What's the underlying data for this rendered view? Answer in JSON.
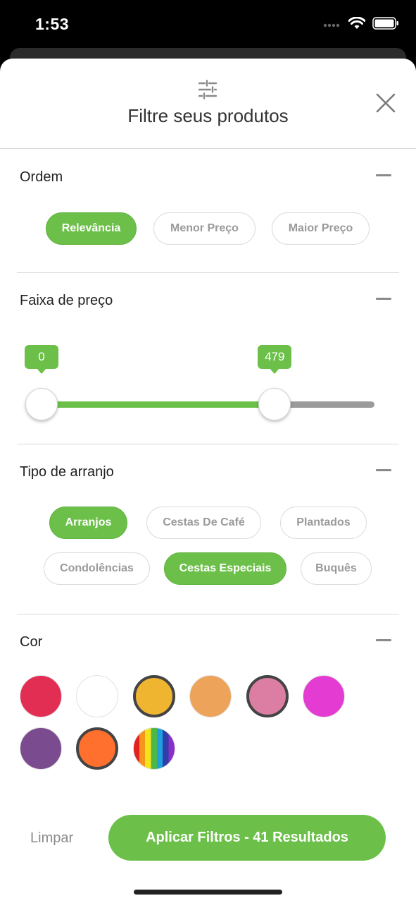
{
  "status_bar": {
    "time": "1:53",
    "icons": [
      "signal-icon",
      "wifi-icon",
      "battery-icon"
    ]
  },
  "header": {
    "title": "Filtre seus produtos",
    "icon": "filter-sliders-icon",
    "close_icon": "close-icon"
  },
  "sections": {
    "ordem": {
      "title": "Ordem",
      "options": [
        {
          "label": "Relevância",
          "selected": true
        },
        {
          "label": "Menor Preço",
          "selected": false
        },
        {
          "label": "Maior Preço",
          "selected": false
        }
      ]
    },
    "preco": {
      "title": "Faixa de preço",
      "min_label": "0",
      "max_label": "479",
      "selected_fraction": 0.7
    },
    "arranjo": {
      "title": "Tipo de arranjo",
      "options": [
        {
          "label": "Arranjos",
          "selected": true
        },
        {
          "label": "Cestas De Café",
          "selected": false
        },
        {
          "label": "Plantados",
          "selected": false
        },
        {
          "label": "Condolências",
          "selected": false
        },
        {
          "label": "Cestas Especiais",
          "selected": true
        },
        {
          "label": "Buquês",
          "selected": false
        }
      ]
    },
    "cor": {
      "title": "Cor",
      "swatches": [
        {
          "color": "#e22e52",
          "selected": false
        },
        {
          "color": "#ffffff",
          "selected": false
        },
        {
          "color": "#efb430",
          "selected": true
        },
        {
          "color": "#eda45a",
          "selected": false
        },
        {
          "color": "#dc7ea3",
          "selected": true
        },
        {
          "color": "#e43cd2",
          "selected": false
        },
        {
          "color": "#7a4b8e",
          "selected": false
        },
        {
          "color": "#ff6f2e",
          "selected": true
        },
        {
          "color": "rainbow",
          "selected": false
        }
      ]
    }
  },
  "footer": {
    "clear_label": "Limpar",
    "apply_label": "Aplicar Filtros - 41 Resultados"
  },
  "colors": {
    "accent": "#6cc04a",
    "track_inactive": "#9b9b9b"
  }
}
